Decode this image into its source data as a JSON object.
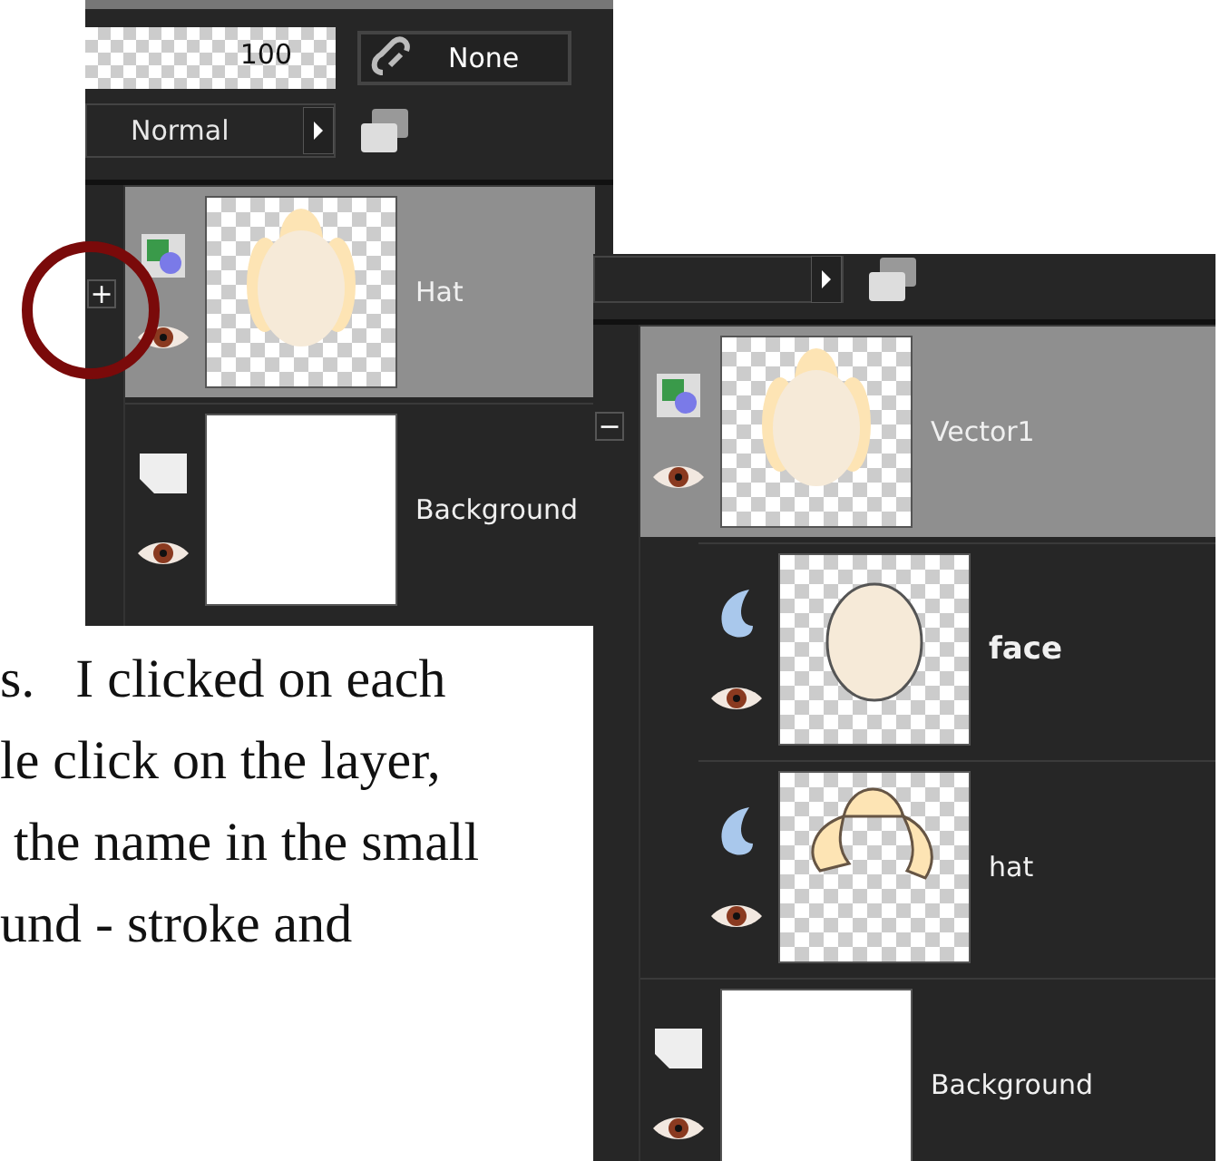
{
  "panels": [
    {
      "opacity": "100",
      "link": "None",
      "blend_mode": "Normal",
      "expander": "+",
      "layers": [
        {
          "name": "Hat",
          "kind": "group",
          "visible": true,
          "selected": true
        },
        {
          "name": "Background",
          "kind": "background",
          "visible": true,
          "selected": false
        }
      ]
    },
    {
      "expander": "−",
      "layers": [
        {
          "name": "Vector1",
          "kind": "group",
          "visible": true,
          "selected": true,
          "children": [
            {
              "name": "face",
              "kind": "object",
              "visible": true,
              "selected": false
            },
            {
              "name": "hat",
              "kind": "object",
              "visible": true,
              "selected": false
            }
          ]
        },
        {
          "name": "Background",
          "kind": "background",
          "visible": true,
          "selected": false
        }
      ]
    }
  ],
  "annotation": {
    "kind": "circle"
  },
  "article": {
    "lines": [
      "s.   I clicked on each",
      "le click on the layer,",
      " the name in the small",
      "und - stroke and"
    ]
  }
}
